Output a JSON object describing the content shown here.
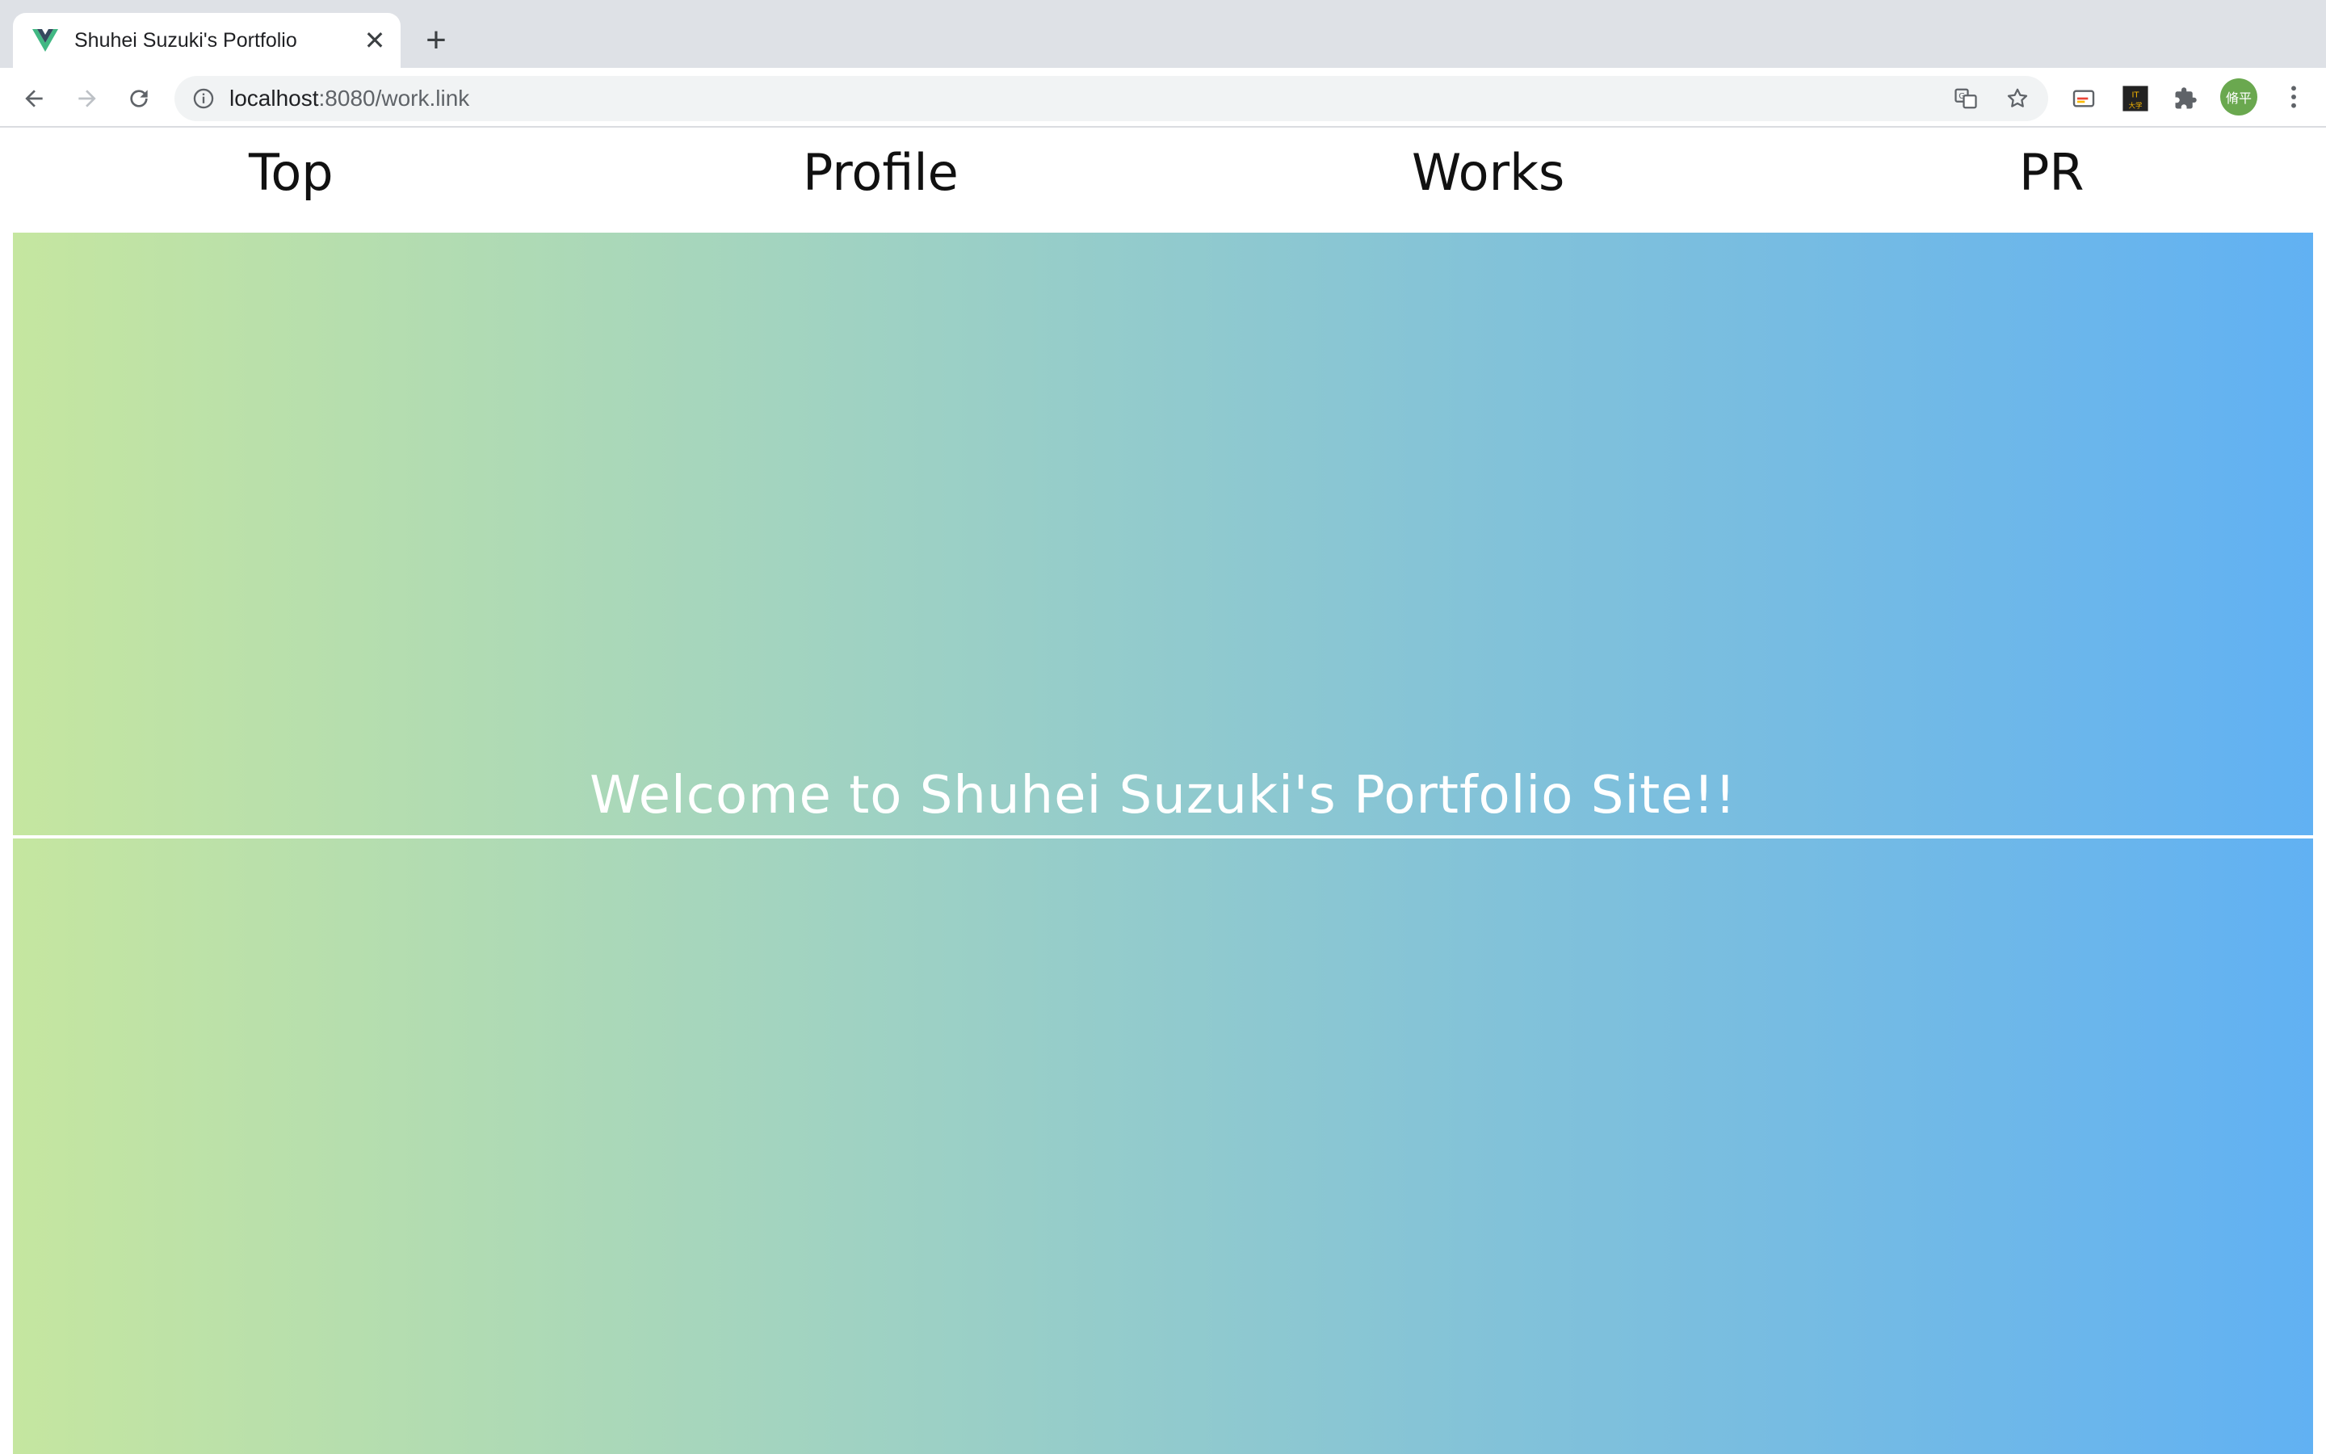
{
  "browser": {
    "tab": {
      "title": "Shuhei Suzuki's Portfolio",
      "favicon": "vue-logo-icon",
      "close_glyph": "✕"
    },
    "new_tab_glyph": "+",
    "address": {
      "host": "localhost",
      "rest": ":8080/work.link"
    },
    "profile_initials": "脩平",
    "extension_badge": "IT大学"
  },
  "site": {
    "nav": {
      "items": [
        {
          "label": "Top"
        },
        {
          "label": "Profile"
        },
        {
          "label": "Works"
        },
        {
          "label": "PR"
        }
      ]
    },
    "hero": {
      "title": "Welcome to Shuhei Suzuki's Portfolio Site!!",
      "gradient": [
        "#c5e6a0",
        "#61b1f3"
      ]
    }
  }
}
